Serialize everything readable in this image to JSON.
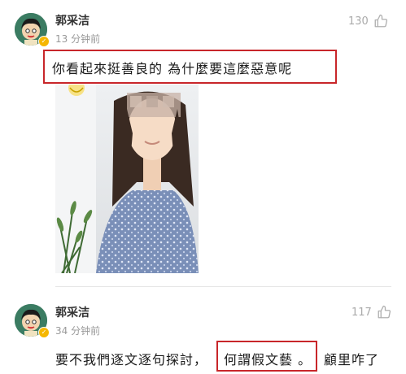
{
  "comments": [
    {
      "username": "郭采洁",
      "time": "13 分钟前",
      "likes": "130",
      "text": "你看起來挺善良的 為什麼要這麼惡意呢"
    },
    {
      "username": "郭采洁",
      "time": "34 分钟前",
      "likes": "117",
      "text_before": "要不我們逐文逐句探討，",
      "text_highlight": "何謂假文藝 。",
      "text_after": "顧里咋了"
    }
  ],
  "icons": {
    "like": "thumbs-up-icon",
    "verified": "verified-badge-icon"
  },
  "colors": {
    "highlight_box": "#c8262a",
    "secondary_text": "#999999"
  }
}
